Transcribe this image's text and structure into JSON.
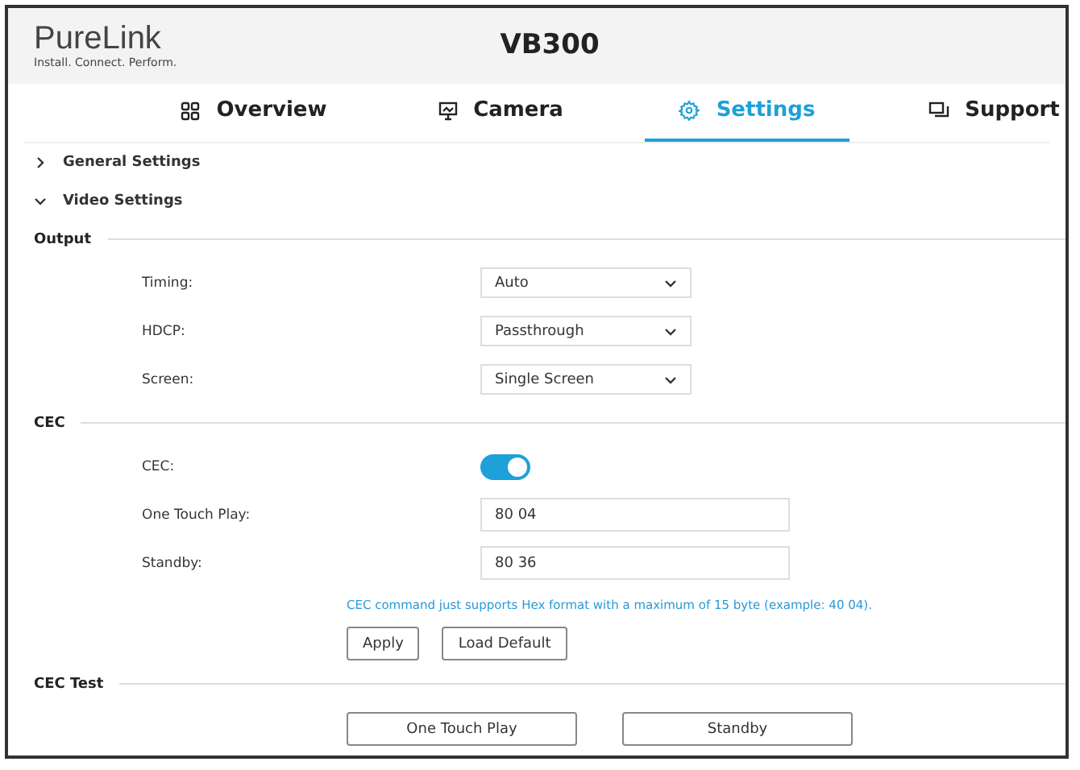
{
  "header": {
    "logo": "PureLink",
    "tagline": "Install. Connect. Perform.",
    "title": "VB300"
  },
  "tabs": [
    {
      "label": "Overview",
      "selected": false
    },
    {
      "label": "Camera",
      "selected": false
    },
    {
      "label": "Settings",
      "selected": true
    },
    {
      "label": "Support",
      "selected": false
    }
  ],
  "panels": [
    {
      "label": "General Settings",
      "expanded": false
    },
    {
      "label": "Video Settings",
      "expanded": true
    }
  ],
  "sections": [
    {
      "title": "Output",
      "rows": [
        {
          "kind": "select",
          "label": "Timing:",
          "value": "Auto"
        },
        {
          "kind": "select",
          "label": "HDCP:",
          "value": "Passthrough"
        },
        {
          "kind": "select",
          "label": "Screen:",
          "value": "Single Screen"
        }
      ]
    },
    {
      "title": "CEC",
      "rows": [
        {
          "kind": "toggle",
          "label": "CEC:",
          "on": true
        },
        {
          "kind": "input",
          "label": "One Touch Play:",
          "value": "80 04"
        },
        {
          "kind": "input",
          "label": "Standby:",
          "value": "80 36"
        },
        {
          "kind": "hint",
          "text": "CEC command just supports Hex format with a maximum of 15 byte (example: 40 04)."
        },
        {
          "kind": "buttons",
          "buttons": [
            "Apply",
            "Load Default"
          ]
        }
      ]
    },
    {
      "title": "CEC Test",
      "rows": [
        {
          "kind": "test_buttons",
          "buttons": [
            "One Touch Play",
            "Standby"
          ]
        }
      ]
    }
  ]
}
